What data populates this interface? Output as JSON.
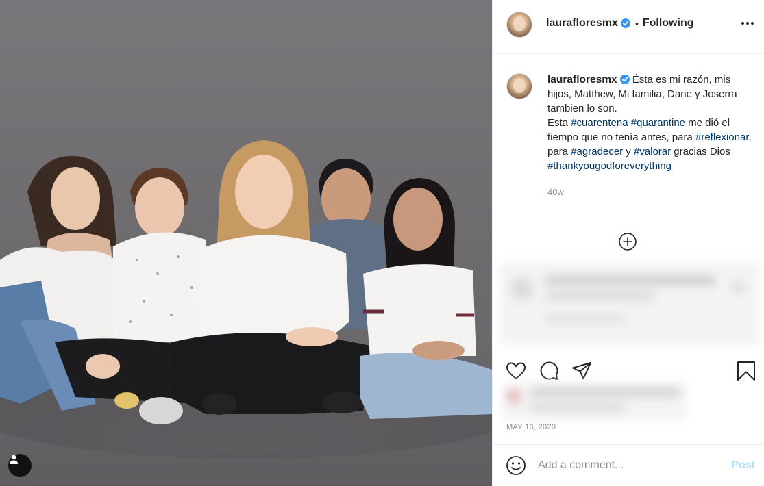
{
  "post": {
    "username": "laurafloresmx",
    "follow_state": "Following",
    "separator": "•",
    "caption": {
      "intro": "Ésta es mi razón, mis hijos, Matthew, Mi familia, Dane y Joserra tambien lo son.",
      "line2_start": "Esta ",
      "tag1": "#cuarentena",
      "tag2": "#quarantine",
      "line2_mid": " me dió el tiempo que no tenía antes, para ",
      "tag3": "#reflexionar",
      "sep1": ", para ",
      "tag4": "#agradecer",
      "sep2": " y ",
      "tag5": "#valorar",
      "line3_end": " gracias Dios",
      "tag6": "#thankyougodforeverything"
    },
    "time_ago": "40w",
    "date": "MAY 16, 2020"
  },
  "comment_box": {
    "placeholder": "Add a comment...",
    "post_label": "Post"
  },
  "icons": {
    "verified": "verified-badge-icon",
    "more": "more-options-icon",
    "load_more": "plus-circle-icon",
    "like": "heart-icon",
    "comment": "comment-bubble-icon",
    "share": "paper-plane-icon",
    "save": "bookmark-icon",
    "emoji": "emoji-smile-icon",
    "user_tags": "user-tags-icon"
  },
  "colors": {
    "verified_blue": "#3897f0",
    "hashtag": "#00376b",
    "post_disabled": "#b2dffc",
    "muted_text": "#8e8e8e"
  }
}
